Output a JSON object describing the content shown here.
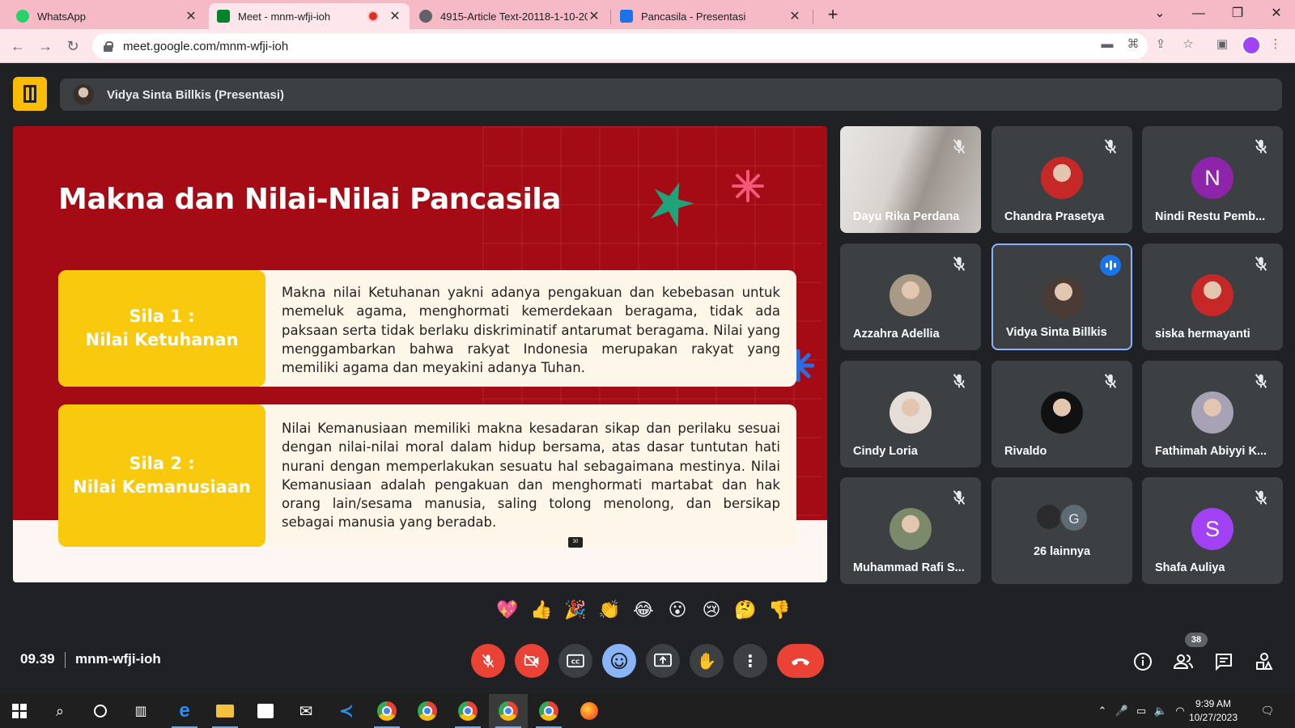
{
  "browser": {
    "tabs": [
      {
        "title": "WhatsApp",
        "icon": "whatsapp-icon",
        "color": "#25d366"
      },
      {
        "title": "Meet - mnm-wfji-ioh",
        "icon": "meet-icon",
        "color": "#00832d"
      },
      {
        "title": "4915-Article Text-20118-1-10-20",
        "icon": "globe-icon",
        "color": "#5f6368"
      },
      {
        "title": "Pancasila - Presentasi",
        "icon": "canva-icon",
        "color": "#1a73e8"
      }
    ],
    "url": "meet.google.com/mnm-wfji-ioh"
  },
  "meet": {
    "presenter_label": "Vidya Sinta Billkis (Presentasi)",
    "time": "09.39",
    "meeting_code": "mnm-wfji-ioh",
    "participant_count": "38"
  },
  "slide": {
    "title": "Makna dan Nilai-Nilai Pancasila",
    "sila1": {
      "label_line1": "Sila 1 :",
      "label_line2": "Nilai Ketuhanan",
      "text": "Makna nilai Ketuhanan yakni adanya pengakuan dan kebebasan untuk memeluk agama, menghormati kemerdekaan beragama, tidak ada paksaan serta tidak berlaku diskriminatif antarumat beragama. Nilai yang menggambarkan bahwa rakyat Indonesia merupakan rakyat yang memiliki agama dan meyakini adanya Tuhan."
    },
    "sila2": {
      "label_line1": "Sila 2 :",
      "label_line2": "Nilai Kemanusiaan",
      "text": "Nilai Kemanusiaan memiliki makna kesadaran sikap dan perilaku sesuai dengan nilai-nilai moral dalam hidup bersama, atas dasar tuntutan hati nurani dengan memperlakukan sesuatu hal sebagaimana mestinya. Nilai Kemanusiaan adalah pengakuan dan menghormati martabat dan hak orang lain/sesama manusia, saling tolong menolong, dan bersikap sebagai manusia yang beradab."
    },
    "page_badge": "30",
    "colors": {
      "background": "#a50b14",
      "label": "#f9c90d",
      "card": "#fdf6e9"
    }
  },
  "participants": [
    {
      "name": "Dayu Rika Perdana",
      "kind": "video"
    },
    {
      "name": "Chandra Prasetya",
      "kind": "photo",
      "color": "#c62828"
    },
    {
      "name": "Nindi Restu Pemb...",
      "kind": "letter",
      "letter": "N",
      "color": "#8e24aa"
    },
    {
      "name": "Azzahra Adellia",
      "kind": "photo",
      "color": "#a89a86"
    },
    {
      "name": "Vidya Sinta Billkis",
      "kind": "photo",
      "color": "#4a3b36",
      "speaking": true
    },
    {
      "name": "siska hermayanti",
      "kind": "photo",
      "color": "#c62828"
    },
    {
      "name": "Cindy Loria",
      "kind": "photo",
      "color": "#e6ddd6"
    },
    {
      "name": "Rivaldo",
      "kind": "photo",
      "color": "#111111"
    },
    {
      "name": "Fathimah Abiyyi K...",
      "kind": "photo",
      "color": "#a7a2b5"
    },
    {
      "name": "Muhammad Rafi S...",
      "kind": "photo",
      "color": "#7a8a6a"
    },
    {
      "name": "26 lainnya",
      "kind": "more",
      "letter": "G"
    },
    {
      "name": "Shafa Auliya",
      "kind": "letter",
      "letter": "S",
      "color": "#a142f4"
    }
  ],
  "reactions": [
    "💖",
    "👍",
    "🎉",
    "👏",
    "😂",
    "😮",
    "😢",
    "🤔",
    "👎"
  ],
  "taskbar": {
    "time": "9:39 AM",
    "date": "10/27/2023"
  }
}
